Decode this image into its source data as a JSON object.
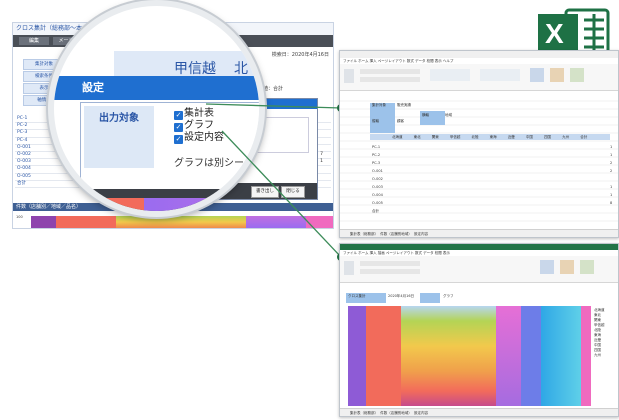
{
  "webapp": {
    "title": "クロス集計（総務部〜本人指示）",
    "toolbar": [
      "編集",
      "メール送信"
    ],
    "date_text": "検索日：2020年4月16日",
    "header_text": "集計値：合計",
    "side_buttons": [
      "集計対象",
      "検索条件",
      "表示",
      "軸情報"
    ],
    "rows": [
      "PC-1",
      "PC-2",
      "PC-3",
      "PC-4",
      "O-001",
      "O-002",
      "O-003",
      "O-004",
      "O-005",
      "合計"
    ],
    "row_values": [
      "",
      "",
      "",
      "",
      "",
      "7",
      "1",
      "",
      "",
      ""
    ],
    "section_title": "件数（店舗別／地域／品名）",
    "chart_axis": "100",
    "dialog_text": "きます。",
    "dialog_buttons": [
      "書き出し",
      "閉じる"
    ]
  },
  "magnifier": {
    "dialog_title": "設定",
    "header_cols": [
      "甲信越",
      "北陸"
    ],
    "label": "出力対象",
    "options": [
      {
        "label": "集計表",
        "checked": true
      },
      {
        "label": "グラフ",
        "checked": true
      },
      {
        "label": "設定内容",
        "checked": true
      }
    ],
    "note": "グラフは別シー"
  },
  "excel_logo": {
    "letter": "X",
    "color": "#1e7145"
  },
  "excel1": {
    "menu": [
      "ファイル",
      "ホーム",
      "挿入",
      "ページレイアウト",
      "数式",
      "データ",
      "校閲",
      "表示",
      "ヘルプ"
    ],
    "info_rows": [
      [
        "集計対象",
        "販売実績"
      ],
      [
        "抽出条件",
        ""
      ],
      [
        "縦軸",
        "顧客"
      ],
      [
        "横軸",
        "地域"
      ],
      [
        "集計値",
        "合計"
      ]
    ],
    "headers": [
      "北海道",
      "東北",
      "関東",
      "甲信越",
      "北陸",
      "東海",
      "近畿",
      "中国",
      "四国",
      "九州",
      "合計"
    ],
    "rows": [
      {
        "label": "PC-1",
        "values": [
          "",
          "1",
          "",
          "",
          "",
          "",
          "",
          "",
          "",
          "",
          "1"
        ]
      },
      {
        "label": "PC-2",
        "values": [
          "",
          "",
          "",
          "",
          "",
          "",
          "",
          "",
          "",
          "",
          ""
        ]
      },
      {
        "label": "PC-3",
        "values": [
          "",
          "1",
          "",
          "",
          "",
          "",
          "",
          "",
          "",
          "",
          "1"
        ]
      },
      {
        "label": "O-001",
        "values": [
          "",
          "",
          "",
          "2",
          "",
          "",
          "",
          "",
          "",
          "",
          "2"
        ]
      },
      {
        "label": "O-002",
        "values": [
          "",
          "",
          "1",
          "",
          "",
          "1",
          "",
          "",
          "",
          "",
          "2"
        ]
      },
      {
        "label": "O-003",
        "values": [
          "",
          "",
          "",
          "",
          "",
          "",
          "",
          "",
          "",
          "",
          ""
        ]
      },
      {
        "label": "O-004",
        "values": [
          "1",
          "",
          "",
          "",
          "",
          "",
          "",
          "",
          "",
          "",
          "1"
        ]
      },
      {
        "label": "O-005",
        "values": [
          "",
          "",
          "",
          "",
          "",
          "",
          "",
          "",
          "",
          "1",
          "1"
        ]
      },
      {
        "label": "合計",
        "values": [
          "1",
          "2",
          "1",
          "2",
          "",
          "1",
          "",
          "",
          "",
          "1",
          "8"
        ]
      }
    ],
    "tabs": [
      "集計表（総務部）",
      "件数（店舗別地域）",
      "設定内容"
    ]
  },
  "excel2": {
    "menu": [
      "ファイル",
      "ホーム",
      "挿入",
      "描画",
      "ページレイアウト",
      "数式",
      "データ",
      "校閲",
      "表示"
    ],
    "info": [
      "クロス集計",
      "グラフ",
      "2020年4月16日"
    ],
    "tabs": [
      "集計表（総務部）",
      "件数（店舗別地域）",
      "設定内容"
    ],
    "legend": [
      "北海道",
      "東北",
      "関東",
      "甲信越",
      "北陸",
      "東海",
      "近畿",
      "中国",
      "四国",
      "九州"
    ]
  },
  "colors": {
    "excel_green": "#217346",
    "app_blue": "#1f6fd0",
    "nav_blue": "#2a56a6"
  }
}
